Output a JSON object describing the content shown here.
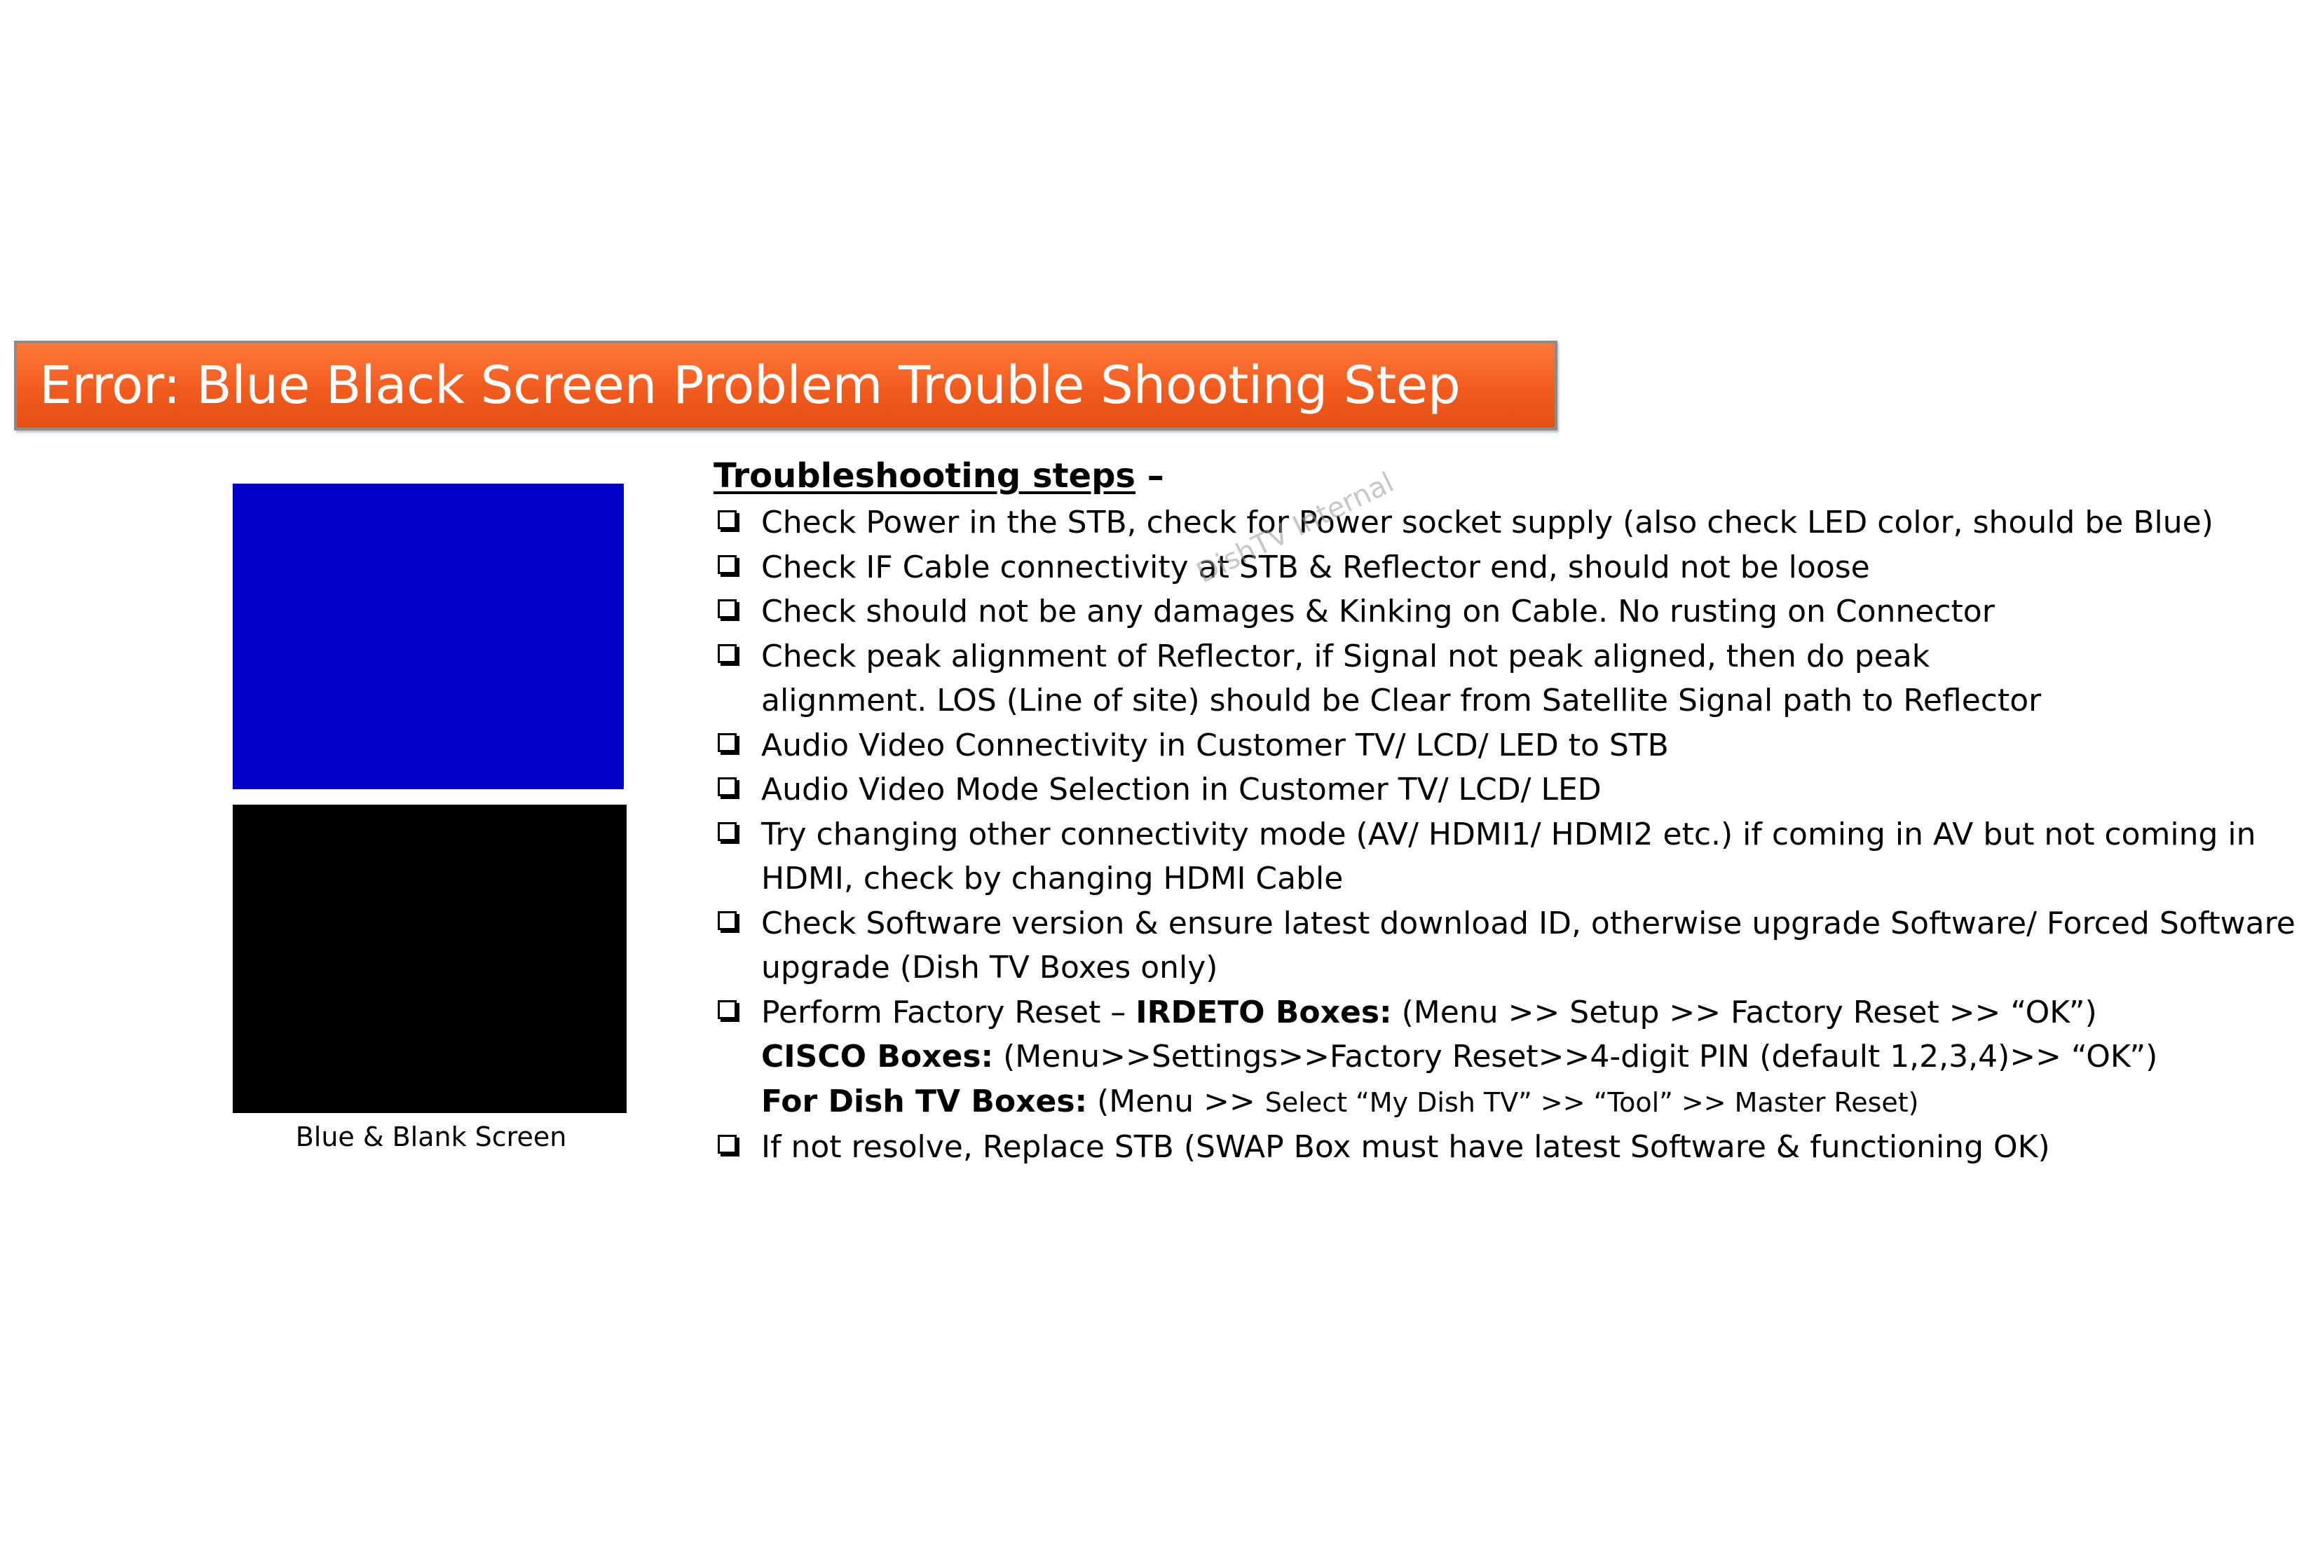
{
  "header": {
    "title": "Error: Blue Black Screen Problem Trouble Shooting Step"
  },
  "illustration": {
    "caption": "Blue & Blank Screen",
    "top_color": "#0000c8",
    "bottom_color": "#000000"
  },
  "watermark": "DishTV Internal",
  "troubleshooting": {
    "heading": "Troubleshooting steps",
    "heading_dash": " –",
    "steps": [
      {
        "lines": [
          "Check Power in the STB, check for Power socket supply (also check LED color, should be Blue)"
        ]
      },
      {
        "lines": [
          "Check IF Cable connectivity at STB & Reflector end, should not be loose"
        ]
      },
      {
        "lines": [
          "Check should not be any damages & Kinking on Cable. No rusting on Connector"
        ]
      },
      {
        "lines": [
          "Check peak alignment of Reflector, if Signal not peak aligned, then do peak",
          "alignment. LOS (Line of site) should be Clear from Satellite Signal path to Reflector"
        ]
      },
      {
        "lines": [
          "Audio Video Connectivity in Customer TV/ LCD/ LED to STB"
        ]
      },
      {
        "lines": [
          "Audio Video Mode Selection in Customer TV/ LCD/ LED"
        ]
      },
      {
        "lines": [
          "Try changing other connectivity mode (AV/ HDMI1/ HDMI2 etc.) if coming in AV but not coming in",
          "HDMI, check by changing HDMI Cable"
        ]
      },
      {
        "lines": [
          "Check Software version & ensure latest download ID, otherwise upgrade Software/ Forced Software",
          "upgrade (Dish TV Boxes only)"
        ]
      },
      {
        "factory_reset": {
          "intro": "Perform Factory Reset – ",
          "irdeto_label": "IRDETO Boxes:",
          "irdeto_text": " (Menu >> Setup >> Factory Reset >> “OK”)",
          "cisco_label": "CISCO Boxes:",
          "cisco_text": " (Menu>>Settings>>Factory Reset>>4-digit PIN (default 1,2,3,4)>> “OK”)",
          "dish_label": "For Dish TV Boxes:",
          "dish_text_a": " (Menu >> ",
          "dish_text_b": "Select “My Dish TV” >> “Tool” >> Master Reset)"
        }
      },
      {
        "lines": [
          "If not resolve, Replace STB (SWAP Box must have latest Software & functioning OK)"
        ]
      }
    ]
  }
}
